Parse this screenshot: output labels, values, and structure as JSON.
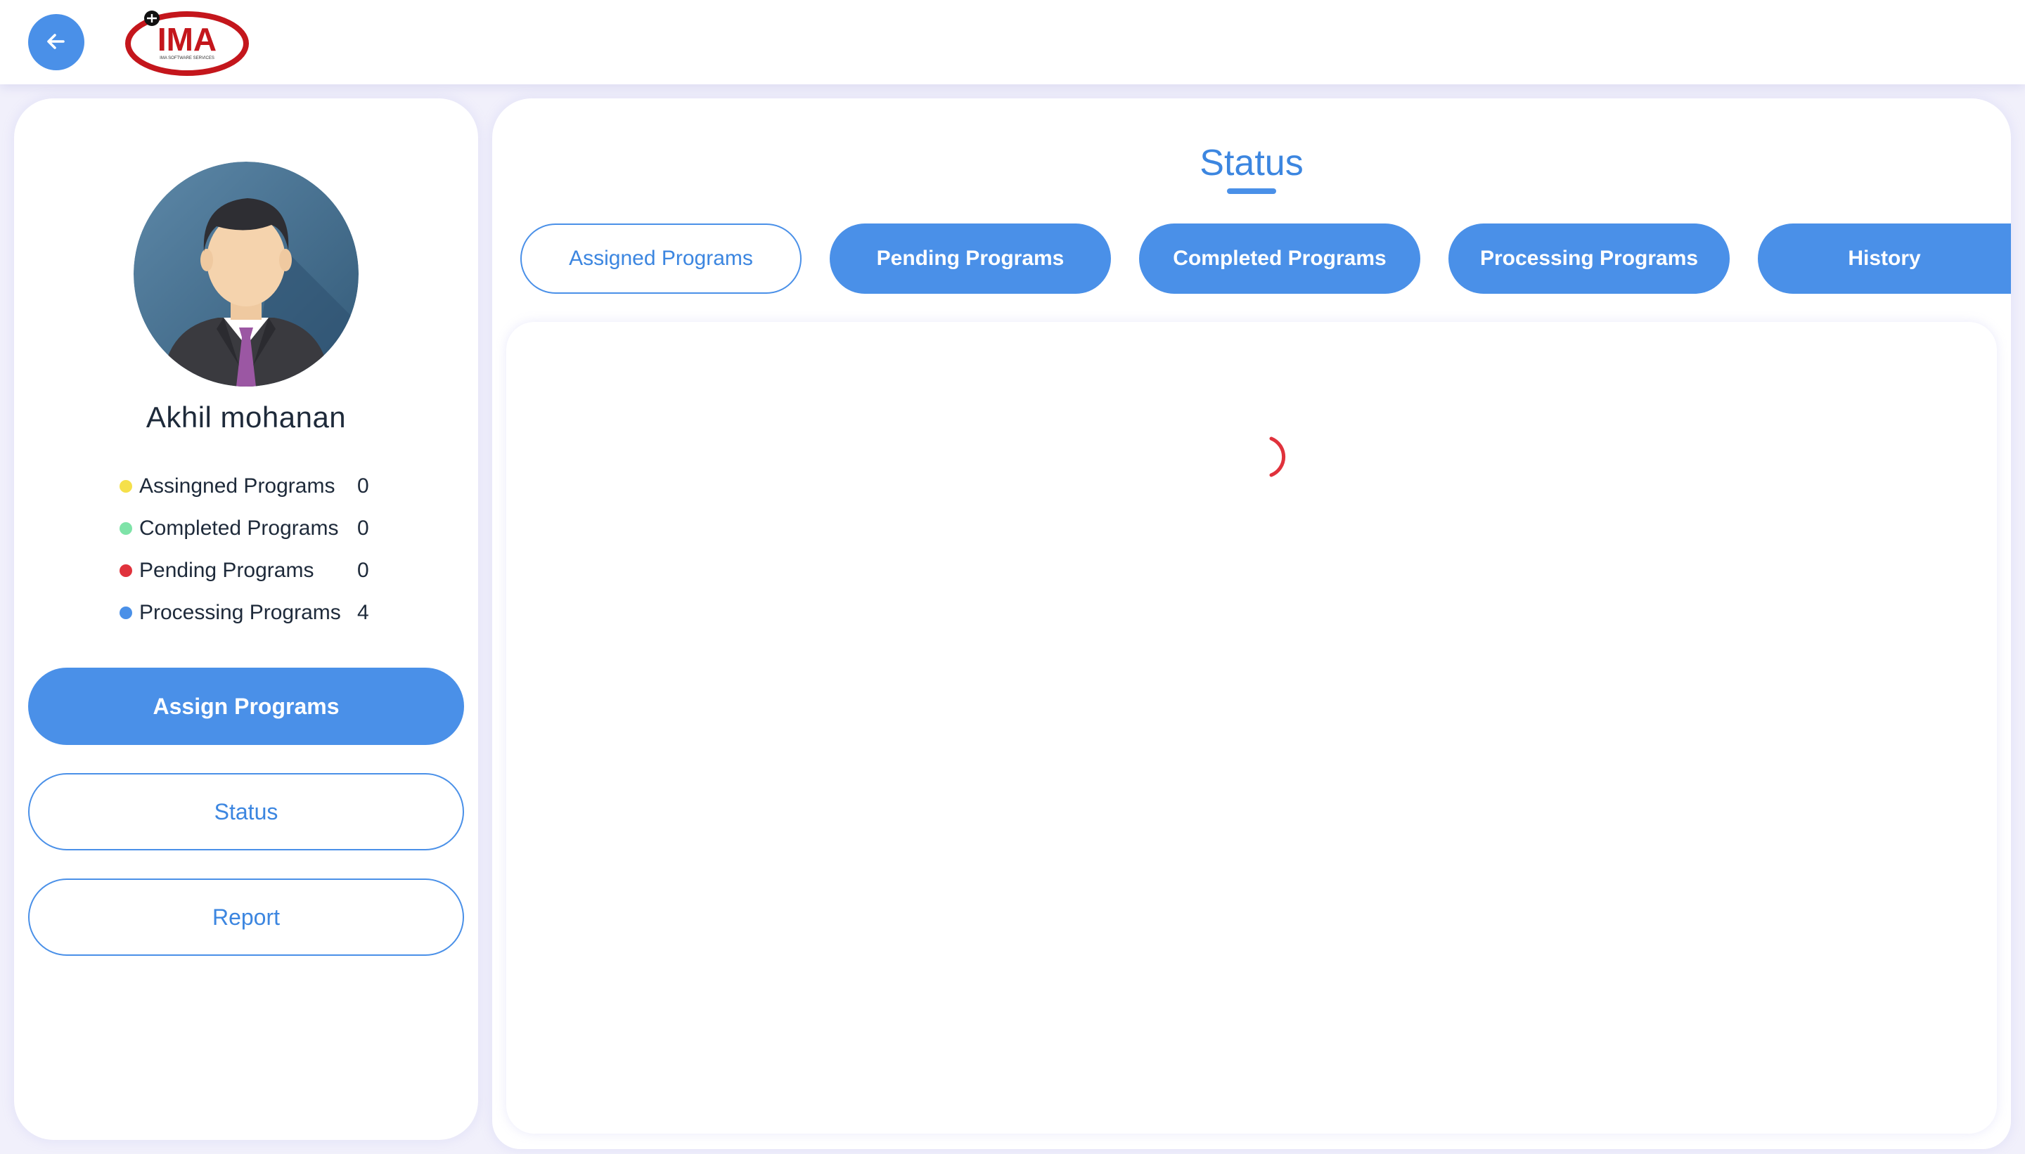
{
  "header": {
    "back_icon": "arrow-left-icon",
    "logo": {
      "text": "IMA",
      "tagline": "IMA SOFTWARE SERVICES"
    },
    "colors": {
      "back_button": "#4a90e8",
      "logo_red": "#c4161c"
    }
  },
  "profile": {
    "name": "Akhil mohanan",
    "avatar_icon": "businessman-avatar-icon",
    "stats": [
      {
        "label": "Assingned Programs",
        "count": "0",
        "color": "#f5e04a"
      },
      {
        "label": "Completed Programs",
        "count": "0",
        "color": "#7ee3a8"
      },
      {
        "label": "Pending Programs",
        "count": "0",
        "color": "#e0323c"
      },
      {
        "label": "Processing Programs",
        "count": "4",
        "color": "#4a90e8"
      }
    ],
    "buttons": {
      "assign": "Assign Programs",
      "status": "Status",
      "report": "Report"
    }
  },
  "main": {
    "title": "Status",
    "tabs": [
      {
        "label": "Assigned Programs",
        "active": true
      },
      {
        "label": "Pending Programs",
        "active": false
      },
      {
        "label": "Completed Programs",
        "active": false
      },
      {
        "label": "Processing Programs",
        "active": false
      },
      {
        "label": "History",
        "active": false
      }
    ],
    "content": {
      "state": "loading",
      "spinner_color": "#e0323c"
    }
  },
  "theme": {
    "accent": "#4a90e8",
    "page_background": "#f1f0fb"
  }
}
